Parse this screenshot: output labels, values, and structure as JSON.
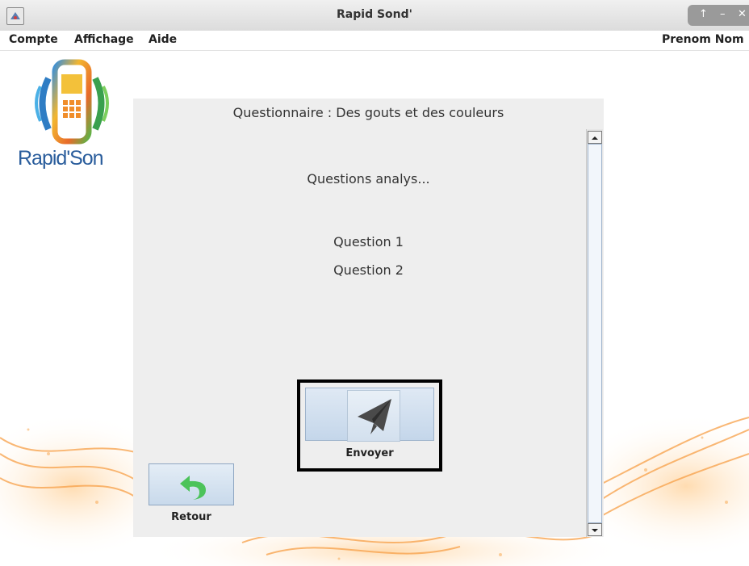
{
  "window": {
    "title": "Rapid Sond'",
    "controls": [
      "↑",
      "–",
      "✕"
    ]
  },
  "menu": {
    "items": [
      "Compte",
      "Affichage",
      "Aide"
    ],
    "user": "Prenom Nom"
  },
  "logo": {
    "text": "Rapid'Son"
  },
  "panel": {
    "title": "Questionnaire : Des gouts et des couleurs",
    "section_label": "Questions analys...",
    "questions": [
      "Question 1",
      "Question 2"
    ]
  },
  "buttons": {
    "send_label": "Envoyer",
    "back_label": "Retour"
  },
  "colors": {
    "panel_bg": "#eeeeee",
    "button_blue": "#c8d9eb",
    "back_arrow": "#4cc35a",
    "orange_wave": "#f7a048"
  },
  "icons": {
    "send": "paper-plane-icon",
    "back": "undo-arrow-icon",
    "app": "app-icon"
  }
}
